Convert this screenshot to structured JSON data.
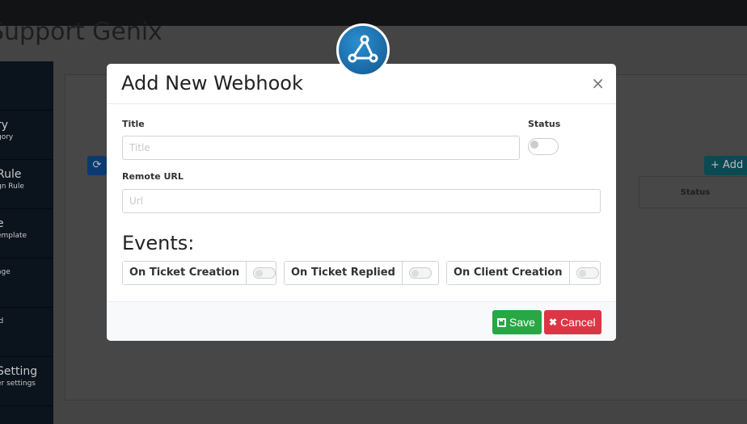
{
  "app": {
    "title": "Support Genix"
  },
  "sidebar": {
    "items": [
      {
        "label": "",
        "sub": ""
      },
      {
        "label": "ry",
        "sub": "gory"
      },
      {
        "label": "Rule",
        "sub": "gn Rule"
      },
      {
        "label": "e",
        "sub": "emplate"
      },
      {
        "label": "",
        "sub": "age"
      },
      {
        "label": "",
        "sub": "ld"
      },
      {
        "label": "Setting",
        "sub": "er settings"
      }
    ]
  },
  "background": {
    "add_button": "+ Add",
    "status_header": "Status"
  },
  "modal": {
    "title": "Add New Webhook",
    "close_label": "×",
    "title_label": "Title",
    "title_placeholder": "Title",
    "title_value": "",
    "status_label": "Status",
    "status_on": false,
    "url_label": "Remote URL",
    "url_placeholder": "Url",
    "url_value": "",
    "events_heading": "Events:",
    "events": [
      {
        "label": "On Ticket Creation",
        "on": false
      },
      {
        "label": "On Ticket Replied",
        "on": false
      },
      {
        "label": "On Client Creation",
        "on": false
      }
    ],
    "save_label": "Save",
    "cancel_label": "Cancel"
  },
  "colors": {
    "save": "#28a745",
    "cancel": "#dc3545",
    "logo": "#1a6fb0"
  },
  "icons": {
    "logo": "webhook-icon",
    "save": "floppy-disk-icon",
    "cancel": "times-icon"
  }
}
